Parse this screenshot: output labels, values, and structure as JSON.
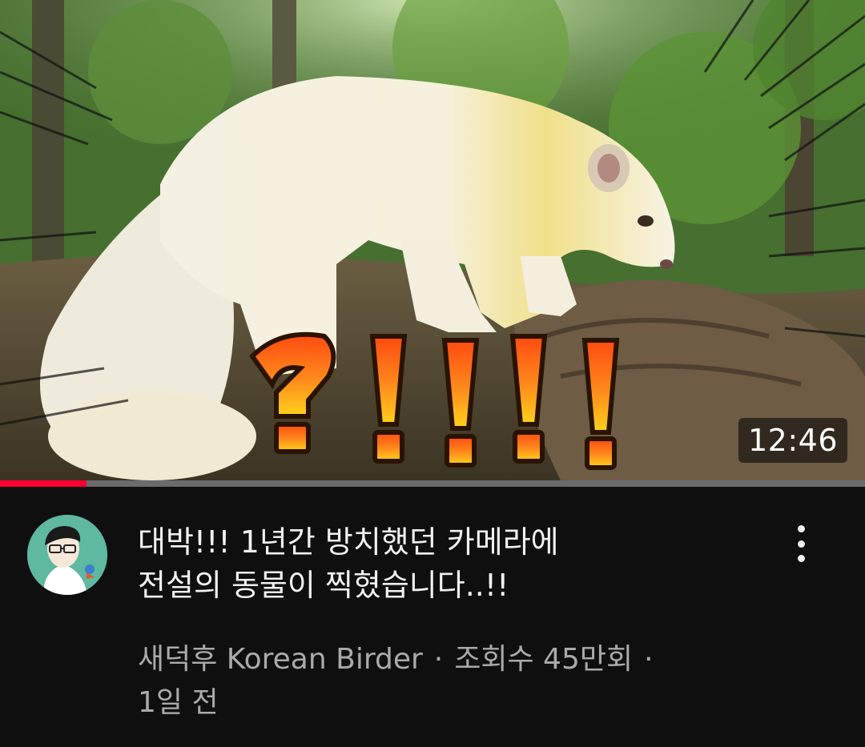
{
  "video": {
    "duration": "12:46",
    "watched_fraction": 0.1,
    "title_line1": "대박!!! 1년간 방치했던 카메라에",
    "title_line2": "전설의 동물이 찍혔습니다..!!",
    "channel": "새덕후 Korean Birder",
    "views": "조회수 45만회",
    "age": "1일 전",
    "separator": "·",
    "thumbnail_overlay_text": "?!!!!"
  },
  "icons": {
    "more": "more-vert-icon"
  },
  "colors": {
    "background": "#0f0f0f",
    "progress": "#ff0033",
    "title": "#f1f1f1",
    "meta": "#aaaaaa"
  }
}
